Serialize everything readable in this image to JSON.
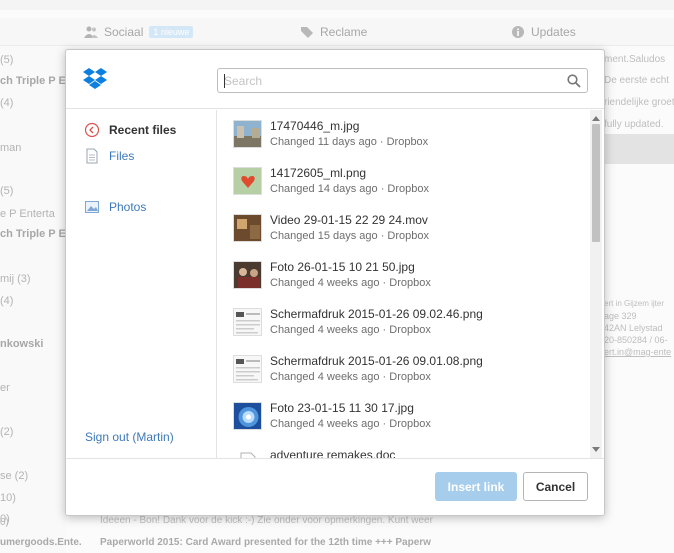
{
  "background": {
    "tabs": [
      {
        "label": "Sociaal",
        "badge": "1 nieuwe",
        "icon": "people-icon"
      },
      {
        "label": "Reclame",
        "icon": "tag-icon"
      },
      {
        "label": "Updates",
        "icon": "info-icon"
      }
    ],
    "left_items": [
      "(5)",
      "ch Triple P E",
      "(4)",
      "man",
      "(5)",
      "e P Enterta",
      "ch Triple P E",
      "mij (3)",
      "(4)",
      "nkowski",
      "er",
      "(2)",
      "se (2)",
      "10)",
      "0)",
      "umergoods.Ente."
    ],
    "right_items": [
      "ment.Saludos",
      "De eerste echt",
      "riendelijke groet",
      "fully updated.",
      "ert in Gijzem ijter",
      "age 329",
      "42AN Lelystad",
      "20-850284 / 06-",
      "ert.in@mag-ente"
    ],
    "bottom": {
      "row1": "Ideeen - Bon! Dank voor de kick :-) Zie onder voor opmerkingen. Kunt weer",
      "row2": "Paperworld 2015: Card Award presented for the 12th time +++ Paperw"
    }
  },
  "dialog": {
    "search": {
      "placeholder": "Search",
      "value": ""
    },
    "nav": {
      "items": [
        {
          "label": "Recent files",
          "icon": "clock-icon",
          "active": true
        },
        {
          "label": "Files",
          "icon": "file-icon",
          "active": false
        },
        {
          "label": "Photos",
          "icon": "photo-icon",
          "active": false
        }
      ],
      "signout": "Sign out (Martin)"
    },
    "files": [
      {
        "name": "17470446_m.jpg",
        "meta": "Changed 11 days ago · Dropbox",
        "thumb": "photo-street"
      },
      {
        "name": "14172605_ml.png",
        "meta": "Changed 14 days ago · Dropbox",
        "thumb": "photo-heart"
      },
      {
        "name": "Video 29-01-15 22 29 24.mov",
        "meta": "Changed 15 days ago · Dropbox",
        "thumb": "video-room"
      },
      {
        "name": "Foto 26-01-15 10 21 50.jpg",
        "meta": "Changed 4 weeks ago · Dropbox",
        "thumb": "photo-people"
      },
      {
        "name": "Schermafdruk 2015-01-26 09.02.46.png",
        "meta": "Changed 4 weeks ago · Dropbox",
        "thumb": "screenshot"
      },
      {
        "name": "Schermafdruk 2015-01-26 09.01.08.png",
        "meta": "Changed 4 weeks ago · Dropbox",
        "thumb": "screenshot"
      },
      {
        "name": "Foto 23-01-15 11 30 17.jpg",
        "meta": "Changed 4 weeks ago · Dropbox",
        "thumb": "photo-globe"
      },
      {
        "name": "adventure remakes.doc",
        "meta": "",
        "thumb": "document"
      }
    ],
    "buttons": {
      "insert": "Insert link",
      "cancel": "Cancel"
    },
    "colors": {
      "link": "#3d79ba",
      "insert_button": "#a6cdeb",
      "dropbox_blue": "#0d7fe0"
    }
  }
}
